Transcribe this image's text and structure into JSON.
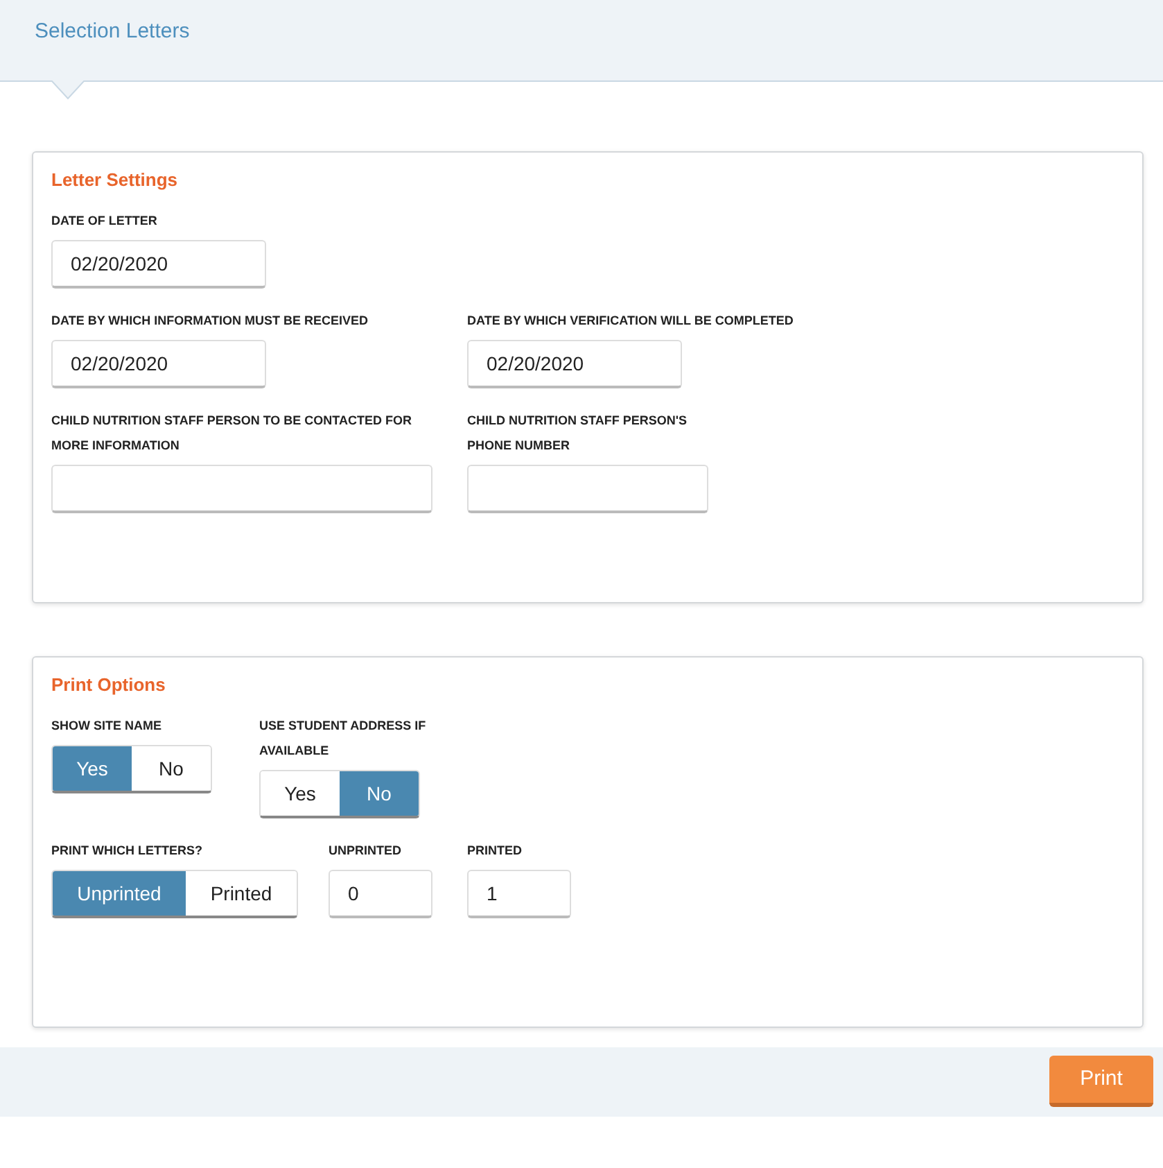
{
  "header": {
    "title": "Selection Letters"
  },
  "sections": [
    {
      "title": "Letter Settings",
      "rows": [
        [
          {
            "kind": "date",
            "label": "DATE OF LETTER",
            "value": "02/20/2020"
          }
        ],
        [
          {
            "kind": "date",
            "label": "DATE BY WHICH INFORMATION MUST BE RECEIVED",
            "value": "02/20/2020"
          },
          {
            "kind": "date",
            "label": "DATE BY WHICH VERIFICATION WILL BE COMPLETED",
            "value": "02/20/2020"
          }
        ],
        [
          {
            "kind": "text",
            "label": "CHILD NUTRITION STAFF PERSON TO BE CONTACTED FOR MORE INFORMATION"
          },
          {
            "kind": "phone",
            "label": "CHILD NUTRITION STAFF PERSON'S PHONE NUMBER"
          }
        ]
      ]
    },
    {
      "title": "Print Options",
      "rows": [
        [
          {
            "kind": "toggle",
            "label": "SHOW SITE NAME",
            "options": [
              {
                "label": "Yes",
                "selected": true
              },
              {
                "label": "No",
                "selected": false
              }
            ]
          },
          {
            "kind": "toggle",
            "label": "USE STUDENT ADDRESS IF AVAILABLE",
            "options": [
              {
                "label": "Yes",
                "selected": false
              },
              {
                "label": "No",
                "selected": true
              }
            ]
          }
        ],
        [
          {
            "kind": "toggle",
            "label": "PRINT WHICH LETTERS?",
            "options": [
              {
                "label": "Unprinted",
                "selected": true
              },
              {
                "label": "Printed",
                "selected": false
              }
            ]
          },
          {
            "kind": "number",
            "label": "UNPRINTED",
            "value": "0"
          },
          {
            "kind": "number",
            "label": "PRINTED",
            "value": "1"
          }
        ]
      ]
    }
  ],
  "footer": {
    "button": "Print"
  }
}
